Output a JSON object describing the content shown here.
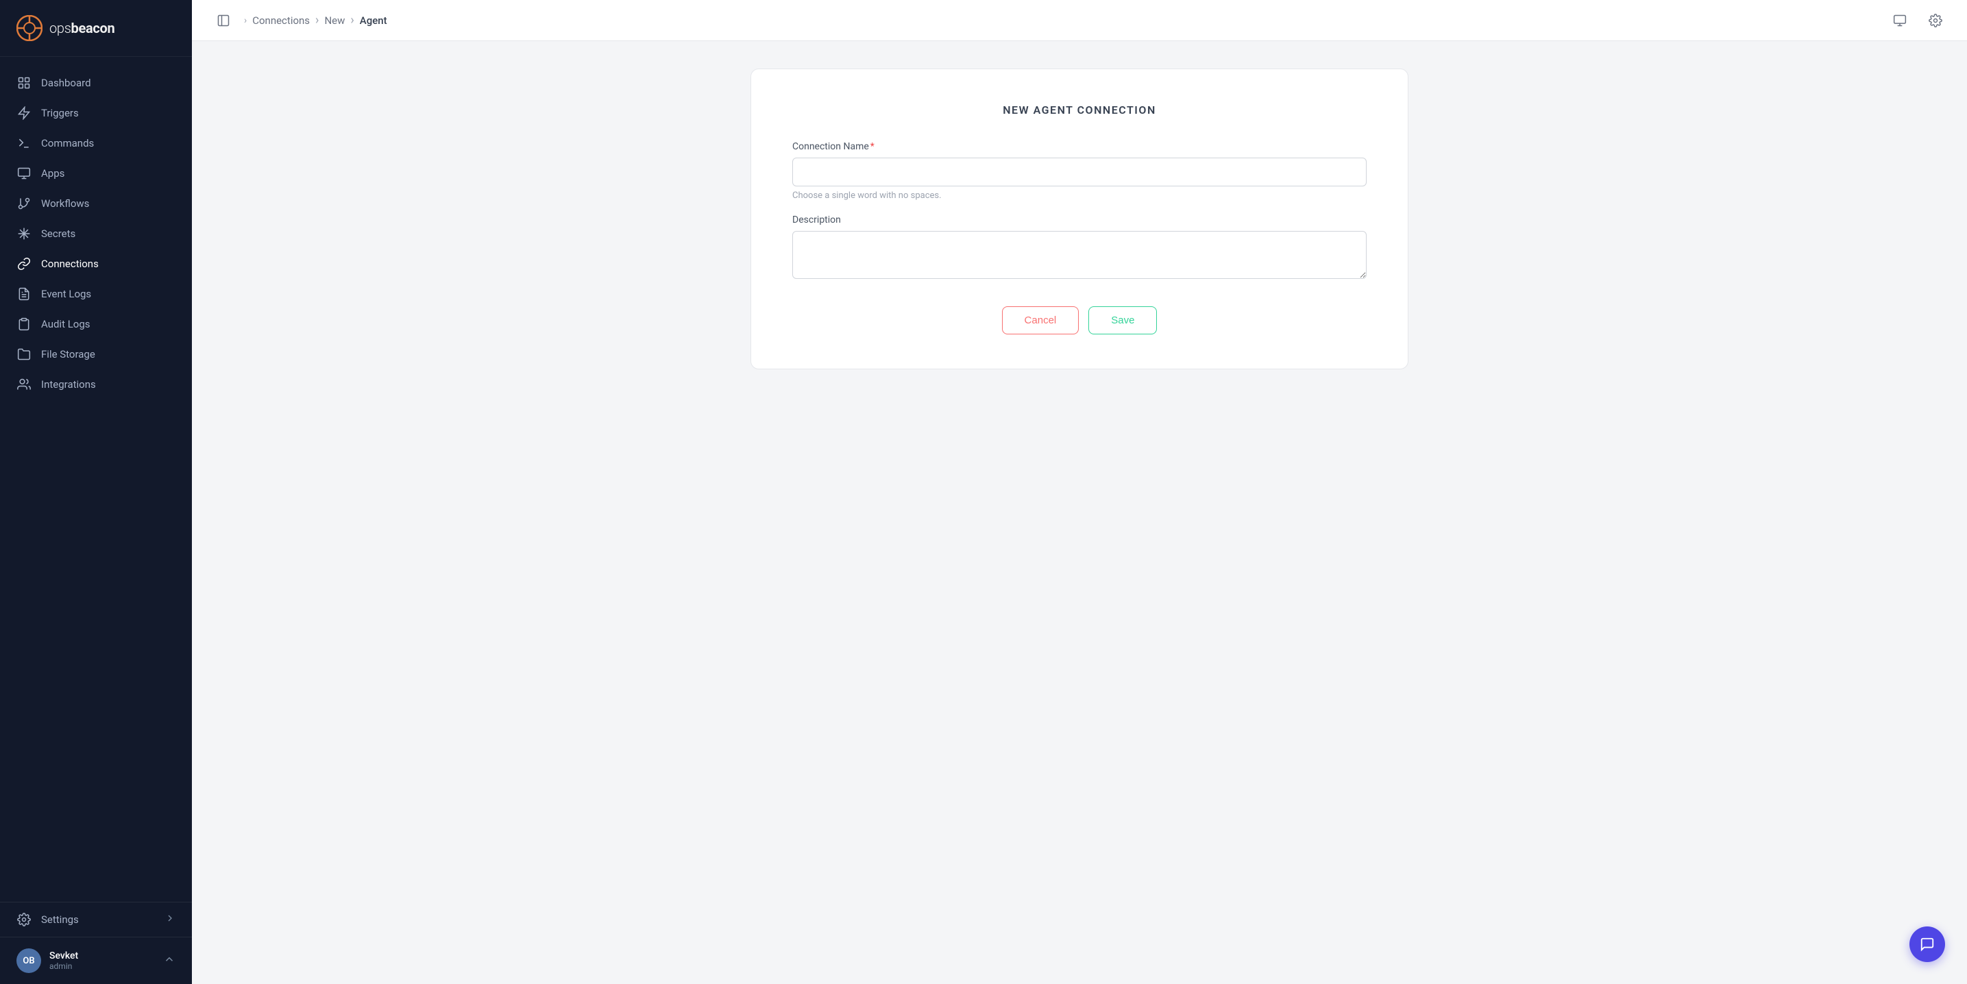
{
  "app": {
    "name_prefix": "ops",
    "name_suffix": "beacon"
  },
  "sidebar": {
    "nav_items": [
      {
        "id": "dashboard",
        "label": "Dashboard",
        "icon": "grid"
      },
      {
        "id": "triggers",
        "label": "Triggers",
        "icon": "zap"
      },
      {
        "id": "commands",
        "label": "Commands",
        "icon": "terminal"
      },
      {
        "id": "apps",
        "label": "Apps",
        "icon": "monitor"
      },
      {
        "id": "workflows",
        "label": "Workflows",
        "icon": "git-branch"
      },
      {
        "id": "secrets",
        "label": "Secrets",
        "icon": "asterisk"
      },
      {
        "id": "connections",
        "label": "Connections",
        "icon": "link"
      },
      {
        "id": "event-logs",
        "label": "Event Logs",
        "icon": "file-text"
      },
      {
        "id": "audit-logs",
        "label": "Audit Logs",
        "icon": "clipboard"
      },
      {
        "id": "file-storage",
        "label": "File Storage",
        "icon": "folder"
      },
      {
        "id": "integrations",
        "label": "Integrations",
        "icon": "users"
      }
    ],
    "settings": {
      "label": "Settings"
    },
    "user": {
      "initials": "OB",
      "name": "Sevket",
      "role": "admin"
    }
  },
  "topbar": {
    "breadcrumb": [
      {
        "label": "Connections",
        "current": false
      },
      {
        "label": "New",
        "current": false
      },
      {
        "label": "Agent",
        "current": true
      }
    ]
  },
  "form": {
    "title": "NEW AGENT CONNECTION",
    "connection_name_label": "Connection Name",
    "connection_name_required": "*",
    "connection_name_placeholder": "",
    "connection_name_hint": "Choose a single word with no spaces.",
    "description_label": "Description",
    "description_placeholder": "",
    "cancel_label": "Cancel",
    "save_label": "Save"
  }
}
